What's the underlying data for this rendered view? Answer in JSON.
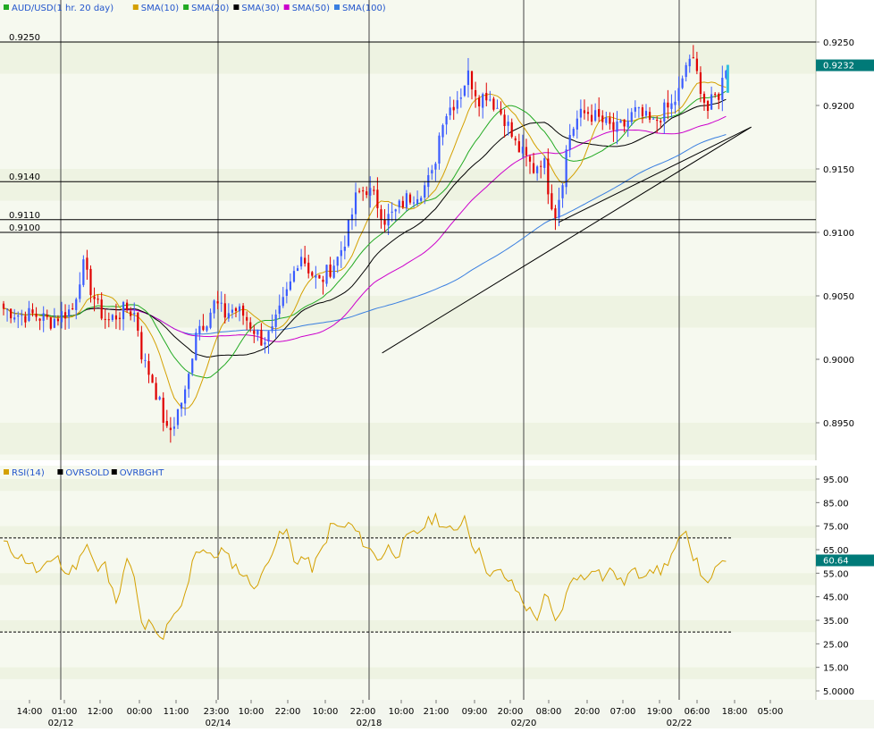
{
  "legend_main": [
    {
      "label": "AUD/USD(1 hr.  20 day)",
      "color": "#22aa22"
    },
    {
      "label": "SMA(10)",
      "color": "#d4a000"
    },
    {
      "label": "SMA(20)",
      "color": "#22aa22"
    },
    {
      "label": "SMA(30)",
      "color": "#000000"
    },
    {
      "label": "SMA(50)",
      "color": "#cc00cc"
    },
    {
      "label": "SMA(100)",
      "color": "#3a7fe0"
    }
  ],
  "legend_rsi": [
    {
      "label": "RSI(14)",
      "color": "#d4a000"
    },
    {
      "label": "OVRSOLD",
      "color": "#000000"
    },
    {
      "label": "OVRBGHT",
      "color": "#000000"
    }
  ],
  "colors": {
    "up": "#3a5bff",
    "down": "#e00000",
    "label_text": "#2255cc",
    "price_tag": "#007a78",
    "band": "#eef3e2",
    "bg": "#f6f9ef",
    "trendline": "#000000",
    "rsi_line": "#d4a000"
  },
  "price_panel": {
    "ylim": [
      0.8925,
      0.926
    ],
    "y_ticks": [
      "0.9250",
      "0.9200",
      "0.9150",
      "0.9100",
      "0.9050",
      "0.9000",
      "0.8950"
    ],
    "hlines": [
      {
        "value": 0.925,
        "label": "0.9250"
      },
      {
        "value": 0.914,
        "label": "0.9140"
      },
      {
        "value": 0.911,
        "label": "0.9110"
      },
      {
        "value": 0.91,
        "label": "0.9100"
      }
    ],
    "last_price": "0.9232"
  },
  "rsi_panel": {
    "ylim": [
      0,
      100
    ],
    "y_ticks": [
      "95.00",
      "85.00",
      "75.00",
      "65.00",
      "55.00",
      "45.00",
      "35.00",
      "25.00",
      "15.00",
      "5.0000"
    ],
    "overbought": 70,
    "oversold": 30,
    "last_value": "60.64"
  },
  "x_axis": {
    "time_ticks": [
      "14:00",
      "01:00",
      "12:00",
      "00:00",
      "11:00",
      "23:00",
      "10:00",
      "22:00",
      "10:00",
      "22:00",
      "10:00",
      "21:00",
      "09:00",
      "20:00",
      "08:00",
      "20:00",
      "07:00",
      "19:00",
      "06:00",
      "18:00",
      "05:00"
    ],
    "date_ticks": [
      "02/12",
      "02/14",
      "02/18",
      "02/20",
      "02/22"
    ]
  },
  "chart_data": {
    "type": "candlestick",
    "symbol": "AUD/USD",
    "interval": "1 hr",
    "n_bars": 200,
    "bar_index_range": [
      0,
      229
    ],
    "close_anchors": [
      [
        0,
        0.904
      ],
      [
        5,
        0.9035
      ],
      [
        10,
        0.9035
      ],
      [
        15,
        0.903
      ],
      [
        18,
        0.9035
      ],
      [
        22,
        0.904
      ],
      [
        25,
        0.9075
      ],
      [
        27,
        0.906
      ],
      [
        30,
        0.904
      ],
      [
        33,
        0.903
      ],
      [
        36,
        0.9035
      ],
      [
        39,
        0.904
      ],
      [
        42,
        0.9035
      ],
      [
        44,
        0.9
      ],
      [
        47,
        0.8985
      ],
      [
        50,
        0.896
      ],
      [
        52,
        0.894
      ],
      [
        54,
        0.895
      ],
      [
        56,
        0.8965
      ],
      [
        58,
        0.8975
      ],
      [
        61,
        0.9025
      ],
      [
        64,
        0.903
      ],
      [
        67,
        0.9045
      ],
      [
        70,
        0.9035
      ],
      [
        73,
        0.904
      ],
      [
        76,
        0.9035
      ],
      [
        79,
        0.9025
      ],
      [
        82,
        0.9015
      ],
      [
        85,
        0.902
      ],
      [
        88,
        0.904
      ],
      [
        91,
        0.906
      ],
      [
        94,
        0.9085
      ],
      [
        97,
        0.907
      ],
      [
        100,
        0.906
      ],
      [
        103,
        0.907
      ],
      [
        106,
        0.908
      ],
      [
        109,
        0.91
      ],
      [
        112,
        0.913
      ],
      [
        115,
        0.9135
      ],
      [
        118,
        0.9125
      ],
      [
        121,
        0.911
      ],
      [
        124,
        0.9115
      ],
      [
        127,
        0.9125
      ],
      [
        130,
        0.913
      ],
      [
        133,
        0.9135
      ],
      [
        136,
        0.9145
      ],
      [
        139,
        0.919
      ],
      [
        142,
        0.92
      ],
      [
        145,
        0.921
      ],
      [
        147,
        0.9225
      ],
      [
        149,
        0.9215
      ],
      [
        151,
        0.9205
      ],
      [
        153,
        0.921
      ],
      [
        156,
        0.92
      ],
      [
        159,
        0.919
      ],
      [
        162,
        0.917
      ],
      [
        165,
        0.916
      ],
      [
        168,
        0.915
      ],
      [
        171,
        0.916
      ],
      [
        173,
        0.913
      ],
      [
        175,
        0.9115
      ],
      [
        177,
        0.914
      ],
      [
        179,
        0.9175
      ],
      [
        182,
        0.919
      ],
      [
        185,
        0.9195
      ],
      [
        188,
        0.919
      ],
      [
        191,
        0.9185
      ],
      [
        194,
        0.918
      ],
      [
        197,
        0.9185
      ],
      [
        200,
        0.9195
      ],
      [
        203,
        0.919
      ],
      [
        206,
        0.9185
      ],
      [
        209,
        0.9195
      ],
      [
        212,
        0.92
      ],
      [
        215,
        0.9215
      ],
      [
        217,
        0.924
      ],
      [
        219,
        0.923
      ],
      [
        221,
        0.9215
      ],
      [
        223,
        0.9195
      ],
      [
        225,
        0.9205
      ],
      [
        227,
        0.921
      ],
      [
        229,
        0.9232
      ]
    ],
    "rsi_anchors": [
      [
        0,
        68
      ],
      [
        4,
        63
      ],
      [
        8,
        60
      ],
      [
        11,
        55
      ],
      [
        14,
        58
      ],
      [
        17,
        64
      ],
      [
        19,
        54
      ],
      [
        22,
        57
      ],
      [
        24,
        60
      ],
      [
        26,
        70
      ],
      [
        28,
        62
      ],
      [
        30,
        55
      ],
      [
        32,
        60
      ],
      [
        34,
        48
      ],
      [
        36,
        44
      ],
      [
        38,
        56
      ],
      [
        40,
        62
      ],
      [
        42,
        48
      ],
      [
        44,
        30
      ],
      [
        46,
        34
      ],
      [
        48,
        30
      ],
      [
        50,
        26
      ],
      [
        52,
        32
      ],
      [
        54,
        36
      ],
      [
        56,
        40
      ],
      [
        58,
        47
      ],
      [
        60,
        63
      ],
      [
        63,
        66
      ],
      [
        66,
        61
      ],
      [
        69,
        65
      ],
      [
        72,
        60
      ],
      [
        75,
        56
      ],
      [
        78,
        51
      ],
      [
        81,
        50
      ],
      [
        84,
        62
      ],
      [
        87,
        70
      ],
      [
        90,
        73
      ],
      [
        92,
        60
      ],
      [
        95,
        62
      ],
      [
        98,
        57
      ],
      [
        101,
        65
      ],
      [
        104,
        76
      ],
      [
        107,
        74
      ],
      [
        110,
        76
      ],
      [
        113,
        70
      ],
      [
        116,
        65
      ],
      [
        119,
        61
      ],
      [
        122,
        66
      ],
      [
        125,
        63
      ],
      [
        128,
        70
      ],
      [
        131,
        72
      ],
      [
        134,
        76
      ],
      [
        137,
        79
      ],
      [
        140,
        74
      ],
      [
        143,
        72
      ],
      [
        146,
        80
      ],
      [
        149,
        66
      ],
      [
        152,
        62
      ],
      [
        154,
        53
      ],
      [
        157,
        56
      ],
      [
        160,
        52
      ],
      [
        163,
        47
      ],
      [
        166,
        40
      ],
      [
        169,
        36
      ],
      [
        172,
        46
      ],
      [
        175,
        33
      ],
      [
        178,
        44
      ],
      [
        181,
        55
      ],
      [
        184,
        52
      ],
      [
        187,
        59
      ],
      [
        190,
        53
      ],
      [
        193,
        57
      ],
      [
        196,
        50
      ],
      [
        199,
        56
      ],
      [
        202,
        54
      ],
      [
        205,
        58
      ],
      [
        208,
        55
      ],
      [
        211,
        61
      ],
      [
        214,
        68
      ],
      [
        216,
        72
      ],
      [
        218,
        63
      ],
      [
        220,
        62
      ],
      [
        222,
        50
      ],
      [
        224,
        54
      ],
      [
        226,
        56
      ],
      [
        229,
        61
      ]
    ],
    "trendlines": [
      {
        "from": [
          120,
          0.9005
        ],
        "to": [
          237,
          0.9183
        ]
      },
      {
        "from": [
          176,
          0.9108
        ],
        "to": [
          237,
          0.9183
        ]
      }
    ]
  }
}
